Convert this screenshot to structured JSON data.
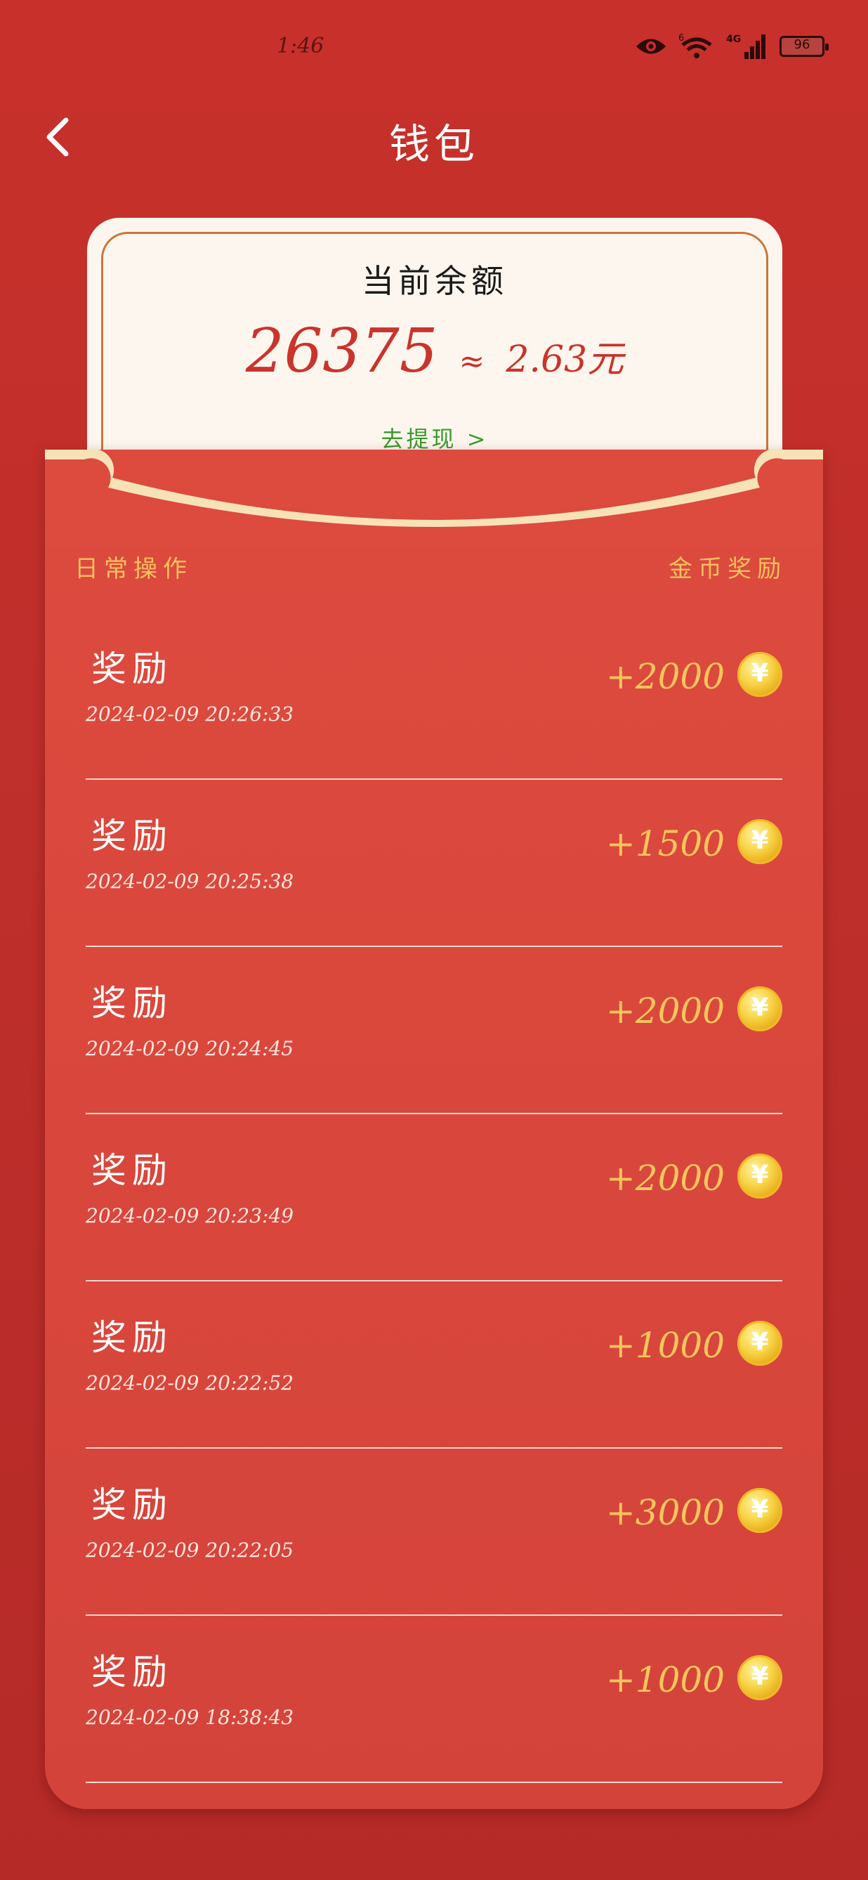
{
  "status_bar": {
    "time": "1:46",
    "battery": "96",
    "icons": [
      "eye-icon",
      "wifi-icon",
      "signal-4g-icon",
      "battery-icon"
    ]
  },
  "header": {
    "title": "钱包",
    "back_icon": "chevron-left-icon"
  },
  "balance": {
    "label": "当前余额",
    "coins": "26375",
    "approx": "≈",
    "yuan": "2.63元",
    "withdraw": "去提现 >"
  },
  "list": {
    "left_header": "日常操作",
    "right_header": "金币奖励",
    "records": [
      {
        "title": "奖励",
        "time": "2024-02-09  20:26:33",
        "amount": "+2000"
      },
      {
        "title": "奖励",
        "time": "2024-02-09  20:25:38",
        "amount": "+1500"
      },
      {
        "title": "奖励",
        "time": "2024-02-09  20:24:45",
        "amount": "+2000"
      },
      {
        "title": "奖励",
        "time": "2024-02-09  20:23:49",
        "amount": "+2000"
      },
      {
        "title": "奖励",
        "time": "2024-02-09  20:22:52",
        "amount": "+1000"
      },
      {
        "title": "奖励",
        "time": "2024-02-09  20:22:05",
        "amount": "+3000"
      },
      {
        "title": "奖励",
        "time": "2024-02-09  18:38:43",
        "amount": "+1000"
      }
    ]
  },
  "coin_symbol": "¥",
  "colors": {
    "background": "#c8302b",
    "envelope": "#dd4a3e",
    "gold": "#f6c65c",
    "card": "#fdf6ee",
    "withdraw_green": "#3b9a2c"
  }
}
